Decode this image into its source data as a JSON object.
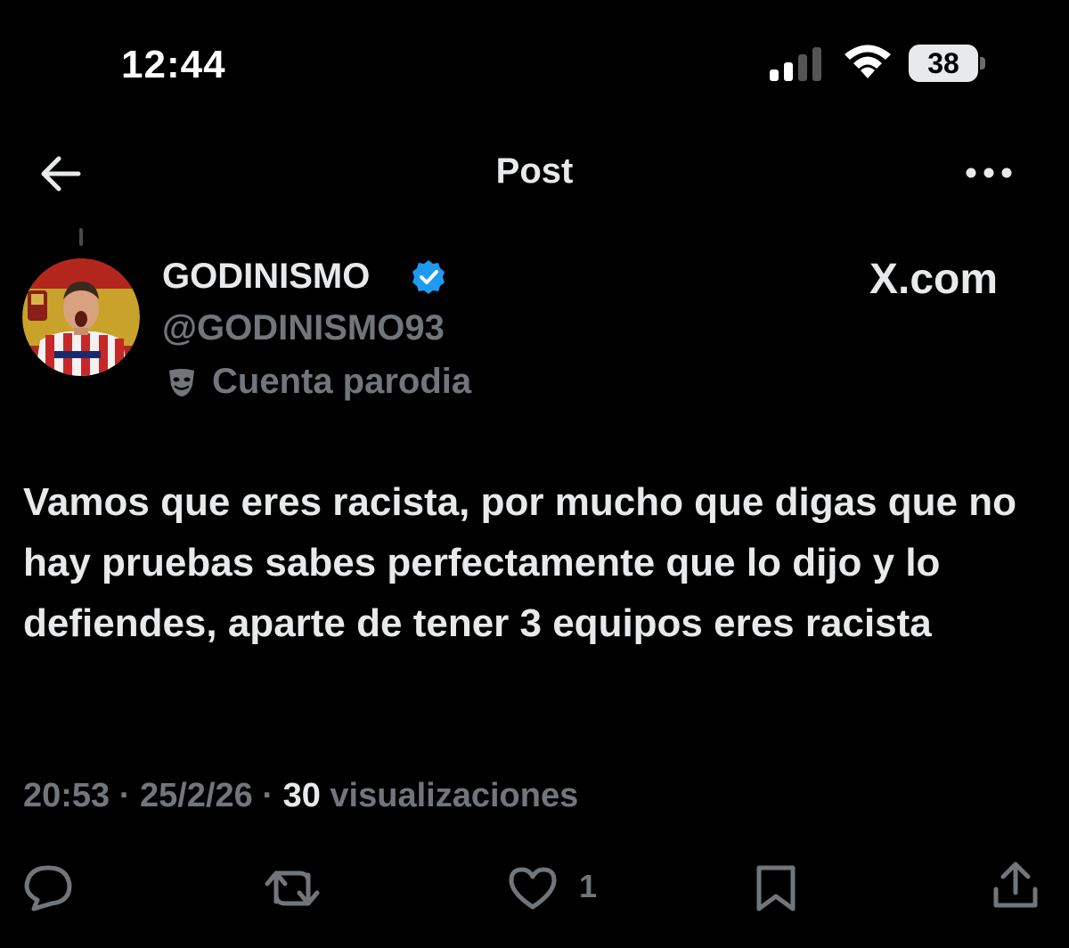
{
  "status_bar": {
    "time": "12:44",
    "battery": "38",
    "icons": [
      "cellular-signal-icon",
      "wifi-icon",
      "battery-icon"
    ]
  },
  "nav": {
    "title": "Post",
    "back_icon": "arrow-left-icon",
    "more_icon": "more-horizontal-icon"
  },
  "author": {
    "name": "GODINISMO",
    "handle": "@GODINISMO93",
    "verified": true,
    "badge_color": "#1d9bf0",
    "parody_label": "Cuenta parodia",
    "parody_icon": "theater-mask-icon"
  },
  "watermark": "X.com",
  "post": {
    "text": "Vamos que eres racista, por mucho que digas que no hay pruebas sabes perfectamente que lo dijo y lo defiendes, aparte de tener 3 equipos eres racista"
  },
  "meta": {
    "time": "20:53",
    "sep": "·",
    "date": "25/2/26",
    "views_count": "30",
    "views_label": "visualizaciones"
  },
  "actions": {
    "reply_icon": "reply-icon",
    "repost_icon": "repost-icon",
    "like_icon": "heart-icon",
    "like_count": "1",
    "bookmark_icon": "bookmark-icon",
    "share_icon": "share-icon"
  },
  "colors": {
    "background": "#000000",
    "text": "#e7e9ea",
    "secondary": "#71767b",
    "accent": "#1d9bf0"
  }
}
